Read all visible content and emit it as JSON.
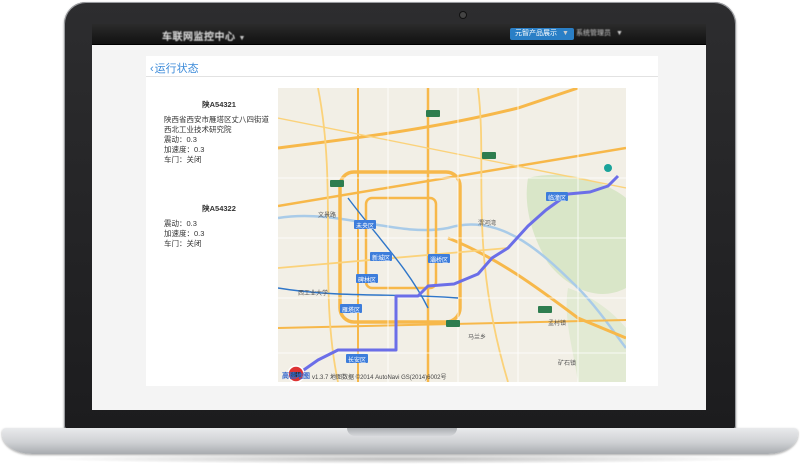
{
  "header": {
    "brand": "车联网监控中心",
    "nav_active": "元智产品展示",
    "nav_item": "系统管理员"
  },
  "panel": {
    "title": "运行状态"
  },
  "vehicles": [
    {
      "plate": "陕A54321",
      "address_line1": "陕西省西安市雁塔区丈八四街道",
      "address_line2": "西北工业技术研究院",
      "vibration": "震动：0.3",
      "acceleration": "加速度：0.3",
      "door": "车门：关闭"
    },
    {
      "plate": "陕A54322",
      "vibration": "震动：0.3",
      "acceleration": "加速度：0.3",
      "door": "车门：关闭"
    }
  ],
  "map": {
    "logo": "高德地图",
    "copyright": "v1.3.7 地图数据 ©2014 AutoNavi GS(2014)6002号",
    "labels": {
      "weiyang": "未央区",
      "xincheng": "新城区",
      "beilin": "碑林区",
      "yanta": "雁塔区",
      "changan": "长安区",
      "baqiao": "灞桥区",
      "lintong": "临潼区",
      "wenjing": "文景路",
      "xiaozhai": "西工业大学",
      "fengqing": "渭河湾",
      "jingwei": "马兰乡",
      "mengcun": "孟村镇",
      "kuangshan": "矿石镇"
    },
    "accent_route": "#6b6ee8",
    "road_major": "#f7b84a",
    "highway_badge": "#2e7d4f"
  }
}
